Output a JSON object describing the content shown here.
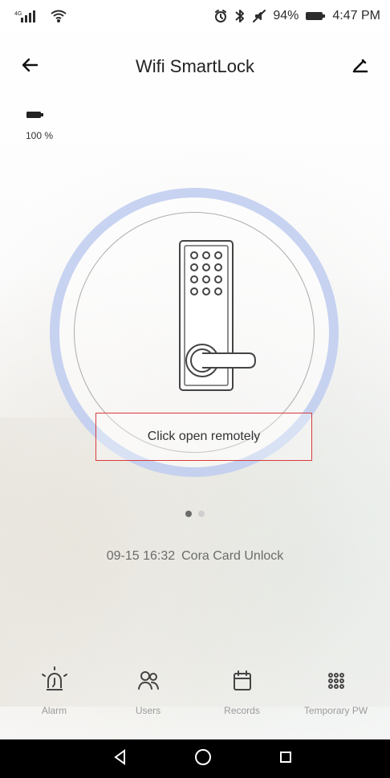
{
  "status_bar": {
    "network_label": "4G",
    "battery_percent": "94%",
    "time": "4:47 PM"
  },
  "header": {
    "title": "Wifi SmartLock",
    "back_icon": "arrow-left-icon",
    "edit_icon": "pencil-icon"
  },
  "lock": {
    "battery_text": "100 %",
    "action_label": "Click open remotely",
    "last_event": {
      "datetime": "09-15 16:32",
      "message": "Cora Card Unlock"
    },
    "pager": {
      "count": 2,
      "active_index": 0
    }
  },
  "toolbar": {
    "items": [
      {
        "label": "Alarm",
        "icon": "alarm-siren-icon"
      },
      {
        "label": "Users",
        "icon": "users-icon"
      },
      {
        "label": "Records",
        "icon": "calendar-icon"
      },
      {
        "label": "Temporary PW",
        "icon": "keypad-icon"
      }
    ]
  },
  "nav": {
    "back_icon": "nav-back-icon",
    "home_icon": "nav-home-icon",
    "recents_icon": "nav-recents-icon"
  },
  "colors": {
    "accent_ring": "#b4c4ec",
    "highlight_box": "#d73b3b",
    "toolbar_text": "#9b9b9b"
  }
}
